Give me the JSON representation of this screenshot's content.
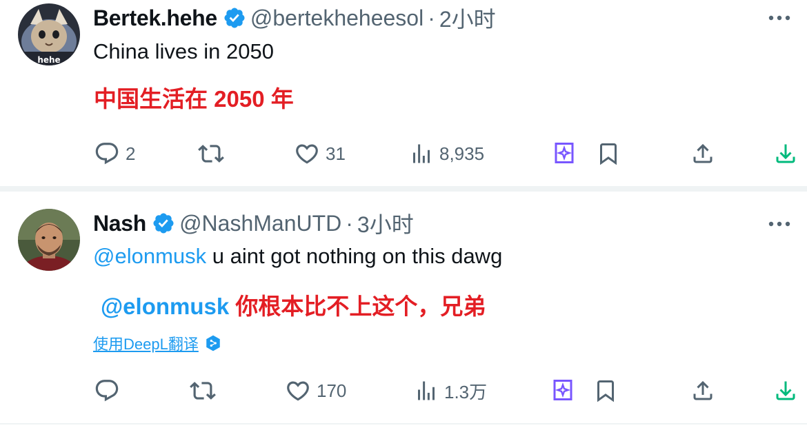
{
  "colors": {
    "text": "#0f1419",
    "secondary": "#536471",
    "accent": "#1d9bf0",
    "translation_red": "#e31e24",
    "grok_purple": "#7856ff",
    "download_green": "#00ba7c"
  },
  "tweets": [
    {
      "display_name": "Bertek.hehe",
      "handle": "@bertekheheesol",
      "separator": "·",
      "time": "2小时",
      "avatar_label": "hehe",
      "text": "China lives in 2050",
      "translation": "中国生活在 2050 年",
      "actions": {
        "reply_icon": "reply-icon",
        "reply_count": "2",
        "retweet_icon": "retweet-icon",
        "retweet_count": "",
        "like_icon": "heart-icon",
        "like_count": "31",
        "views_icon": "views-icon",
        "views_count": "8,935",
        "grok_icon": "grok-icon",
        "bookmark_icon": "bookmark-icon",
        "share_icon": "share-icon",
        "download_icon": "download-icon"
      }
    },
    {
      "display_name": "Nash",
      "handle": "@NashManUTD",
      "separator": "·",
      "time": "3小时",
      "mention": "@elonmusk",
      "text": "u aint got nothing on this dawg",
      "translation_mention": "@elonmusk",
      "translation": "你根本比不上这个，兄弟",
      "translate_link": "使用DeepL翻译",
      "actions": {
        "reply_icon": "reply-icon",
        "reply_count": "",
        "retweet_icon": "retweet-icon",
        "retweet_count": "",
        "like_icon": "heart-icon",
        "like_count": "170",
        "views_icon": "views-icon",
        "views_count": "1.3万",
        "grok_icon": "grok-icon",
        "bookmark_icon": "bookmark-icon",
        "share_icon": "share-icon",
        "download_icon": "download-icon"
      }
    }
  ]
}
